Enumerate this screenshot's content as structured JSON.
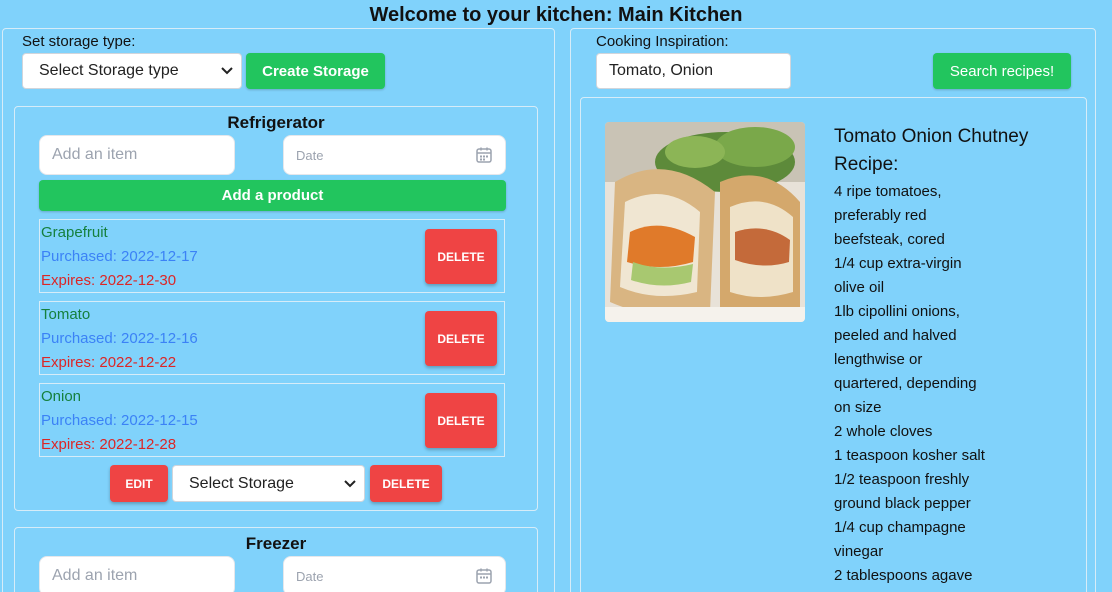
{
  "header": {
    "title": "Welcome to your kitchen: Main Kitchen"
  },
  "storage_panel": {
    "set_type_label": "Set storage type:",
    "type_select_value": "Select Storage type",
    "create_button": "Create Storage"
  },
  "storages": [
    {
      "title": "Refrigerator",
      "item_placeholder": "Add an item",
      "date_placeholder": "Date",
      "add_button": "Add a product",
      "products": [
        {
          "name": "Grapefruit",
          "purchased": "Purchased: 2022-12-17",
          "expires": "Expires: 2022-12-30",
          "delete": "DELETE"
        },
        {
          "name": "Tomato",
          "purchased": "Purchased: 2022-12-16",
          "expires": "Expires: 2022-12-22",
          "delete": "DELETE"
        },
        {
          "name": "Onion",
          "purchased": "Purchased: 2022-12-15",
          "expires": "Expires: 2022-12-28",
          "delete": "DELETE"
        }
      ],
      "footer": {
        "edit": "EDIT",
        "storage_select": "Select Storage",
        "delete": "DELETE"
      }
    },
    {
      "title": "Freezer",
      "item_placeholder": "Add an item",
      "date_placeholder": "Date"
    }
  ],
  "inspiration": {
    "label": "Cooking Inspiration:",
    "search_value": "Tomato, Onion",
    "search_button": "Search recipes!"
  },
  "recipe": {
    "title": "Tomato Onion Chutney",
    "subtitle": "Recipe:",
    "lines": [
      "4 ripe tomatoes,",
      "preferably red",
      "beefsteak, cored",
      "1/4 cup extra-virgin",
      "olive oil",
      "1lb cipollini onions,",
      "peeled and halved",
      "lengthwise or",
      "quartered, depending",
      "on size",
      "2 whole cloves",
      "1 teaspoon kosher salt",
      "1/2 teaspoon freshly",
      "ground black pepper",
      "1/4 cup champagne",
      "vinegar",
      "2 tablespoons agave"
    ]
  },
  "colors": {
    "background": "#80d2fb",
    "green": "#22c55e",
    "red": "#ef4444",
    "name_green": "#15803d",
    "purchased_blue": "#3b82f6",
    "expires_red": "#dc2626"
  }
}
